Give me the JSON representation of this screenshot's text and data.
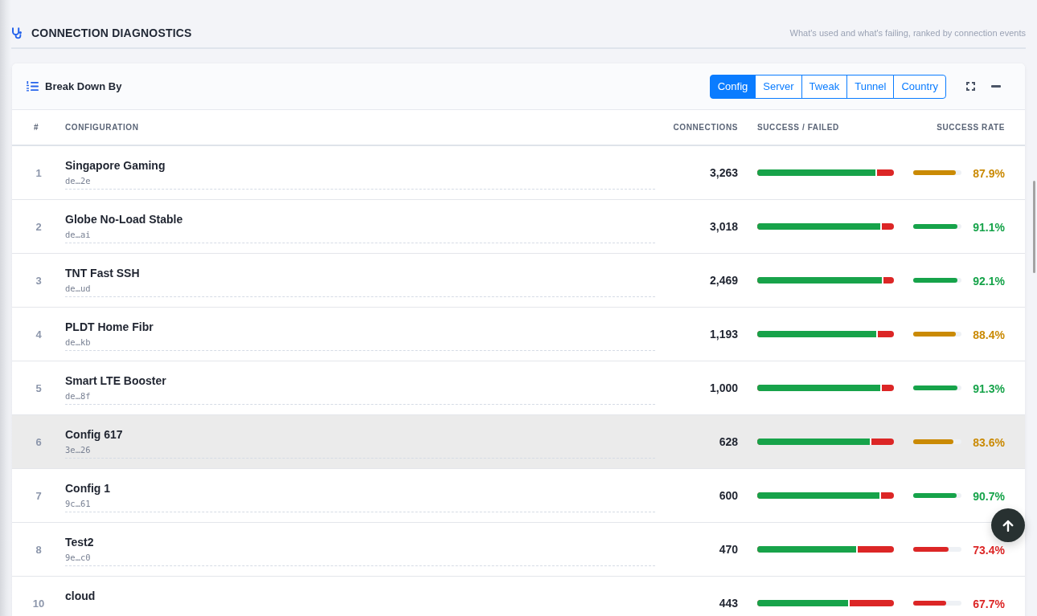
{
  "header": {
    "title": "CONNECTION DIAGNOSTICS",
    "subtitle": "What's used and what's failing, ranked by connection events"
  },
  "panel": {
    "title": "Break Down By",
    "segments": [
      {
        "label": "Config",
        "selected": true
      },
      {
        "label": "Server",
        "selected": false
      },
      {
        "label": "Tweak",
        "selected": false
      },
      {
        "label": "Tunnel",
        "selected": false
      },
      {
        "label": "Country",
        "selected": false
      }
    ]
  },
  "table": {
    "columns": [
      "#",
      "CONFIGURATION",
      "CONNECTIONS",
      "SUCCESS / FAILED",
      "SUCCESS RATE"
    ],
    "rows": [
      {
        "index": "1",
        "name": "Singapore Gaming",
        "id": "de…2e",
        "connections": "3,263",
        "level": 0.879,
        "rate": "87.9%",
        "color": "#ca8a04",
        "highlighted": false
      },
      {
        "index": "2",
        "name": "Globe No-Load Stable",
        "id": "de…ai",
        "connections": "3,018",
        "level": 0.911,
        "rate": "91.1%",
        "color": "#16a34a",
        "highlighted": false
      },
      {
        "index": "3",
        "name": "TNT Fast SSH",
        "id": "de…ud",
        "connections": "2,469",
        "level": 0.921,
        "rate": "92.1%",
        "color": "#16a34a",
        "highlighted": false
      },
      {
        "index": "4",
        "name": "PLDT Home Fibr",
        "id": "de…kb",
        "connections": "1,193",
        "level": 0.884,
        "rate": "88.4%",
        "color": "#ca8a04",
        "highlighted": false
      },
      {
        "index": "5",
        "name": "Smart LTE Booster",
        "id": "de…8f",
        "connections": "1,000",
        "level": 0.913,
        "rate": "91.3%",
        "color": "#16a34a",
        "highlighted": false
      },
      {
        "index": "6",
        "name": "Config 617",
        "id": "3e…26",
        "connections": "628",
        "level": 0.836,
        "rate": "83.6%",
        "color": "#ca8a04",
        "highlighted": true
      },
      {
        "index": "7",
        "name": "Config 1",
        "id": "9c…61",
        "connections": "600",
        "level": 0.907,
        "rate": "90.7%",
        "color": "#16a34a",
        "highlighted": false
      },
      {
        "index": "8",
        "name": "Test2",
        "id": "9e…c0",
        "connections": "470",
        "level": 0.734,
        "rate": "73.4%",
        "color": "#dc2626",
        "highlighted": false
      },
      {
        "index": "10",
        "name": "cloud",
        "connections": "443",
        "level": 0.677,
        "rate": "67.7%",
        "color": "#dc2626",
        "highlighted": false
      }
    ]
  }
}
